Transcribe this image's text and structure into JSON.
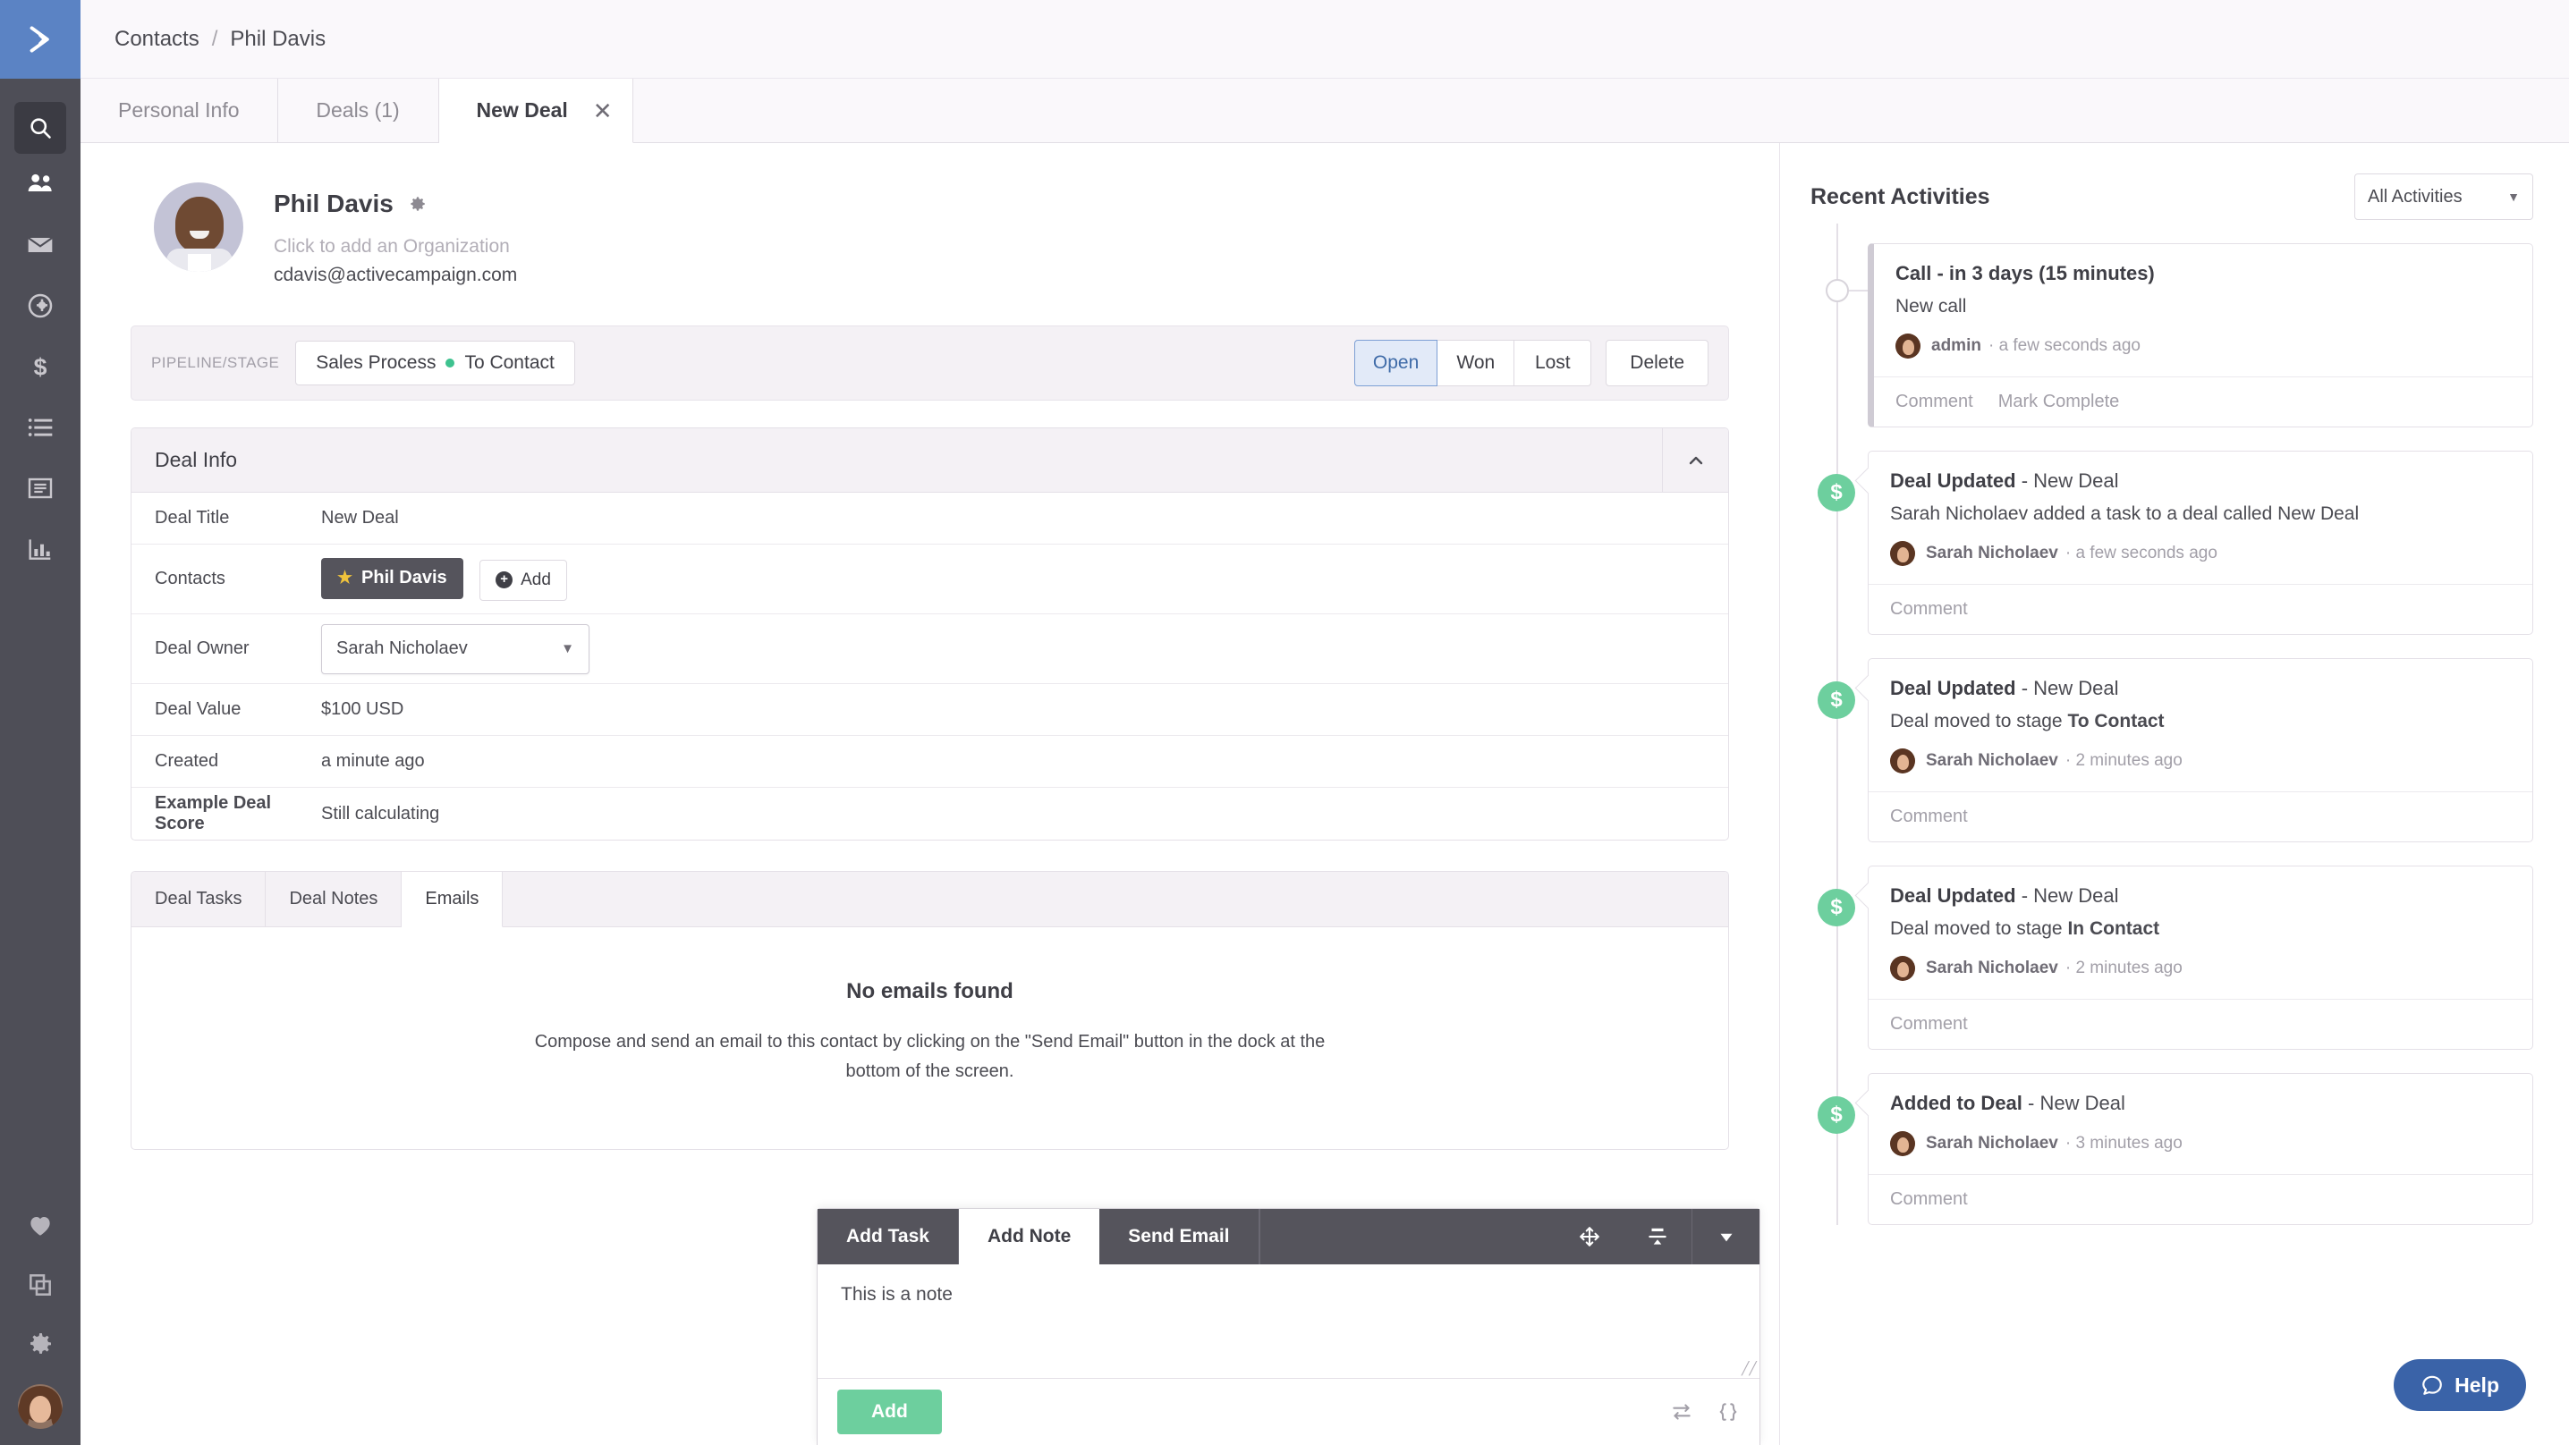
{
  "sidebar": {
    "logo_icon": "chevron-right-logo-icon",
    "search_icon": "search-icon",
    "items": [
      {
        "icon": "contacts-people-icon",
        "name": "contacts"
      },
      {
        "icon": "envelope-campaigns-icon",
        "name": "campaigns"
      },
      {
        "icon": "automations-gear-circle-icon",
        "name": "automations"
      },
      {
        "icon": "deals-dollar-icon",
        "name": "deals"
      },
      {
        "icon": "lists-icon",
        "name": "lists"
      },
      {
        "icon": "forms-document-icon",
        "name": "forms"
      },
      {
        "icon": "reports-bar-chart-icon",
        "name": "reports"
      }
    ],
    "bottom_items": [
      {
        "icon": "heart-icon",
        "name": "favorites"
      },
      {
        "icon": "layers-copy-icon",
        "name": "apps"
      },
      {
        "icon": "gear-settings-icon",
        "name": "settings"
      }
    ],
    "avatar_name": "user-avatar"
  },
  "breadcrumb": {
    "root": "Contacts",
    "separator": "/",
    "current": "Phil Davis"
  },
  "tabs": [
    {
      "label": "Personal Info",
      "active": false,
      "closable": false
    },
    {
      "label": "Deals (1)",
      "active": false,
      "closable": false
    },
    {
      "label": "New Deal",
      "active": true,
      "closable": true
    }
  ],
  "tab_close_glyph": "✕",
  "contact": {
    "name": "Phil Davis",
    "settings_icon": "gear-icon",
    "organization_placeholder": "Click to add an Organization",
    "email": "cdavis@activecampaign.com"
  },
  "pipeline": {
    "label": "PIPELINE/STAGE",
    "pipeline_name": "Sales Process",
    "stage_name": "To Contact",
    "stage_dot_color": "#3ec28f",
    "status_buttons": [
      {
        "label": "Open",
        "active": true
      },
      {
        "label": "Won",
        "active": false
      },
      {
        "label": "Lost",
        "active": false
      }
    ],
    "delete_label": "Delete"
  },
  "deal_info": {
    "title": "Deal Info",
    "collapse_icon": "chevron-up-icon",
    "rows": [
      {
        "label": "Deal Title",
        "value": "New Deal"
      },
      {
        "label": "Contacts",
        "value": ""
      },
      {
        "label": "Deal Owner",
        "value": "Sarah Nicholaev"
      },
      {
        "label": "Deal Value",
        "value": "$100 USD"
      },
      {
        "label": "Created",
        "value": "a minute ago"
      },
      {
        "label": "Example Deal Score",
        "value": "Still calculating"
      }
    ],
    "contact_chip": {
      "star_glyph": "★",
      "label": "Phil Davis"
    },
    "add_contact_label": "Add",
    "add_contact_icon": "plus-circle-icon",
    "owner_value": "Sarah Nicholaev",
    "owner_caret": "▼"
  },
  "deal_tabs": {
    "items": [
      {
        "label": "Deal Tasks",
        "active": false
      },
      {
        "label": "Deal Notes",
        "active": false
      },
      {
        "label": "Emails",
        "active": true
      }
    ],
    "empty_title": "No emails found",
    "empty_body": "Compose and send an email to this contact by clicking on the \"Send Email\" button in the dock at the bottom of the screen."
  },
  "activities": {
    "title": "Recent Activities",
    "filter_value": "All Activities",
    "filter_caret": "▼",
    "items": [
      {
        "kind": "task",
        "marker": "hollow",
        "heading_bold": "Call - in 3 days (15 minutes)",
        "heading_rest": "",
        "description": "New call",
        "author": "admin",
        "time": "a few seconds ago",
        "actions": [
          "Comment",
          "Mark Complete"
        ]
      },
      {
        "kind": "deal",
        "marker": "dollar",
        "heading_bold": "Deal Updated",
        "heading_rest": " - New Deal",
        "description": "Sarah Nicholaev added a task to a deal called New Deal",
        "description_strong": "",
        "author": "Sarah Nicholaev",
        "time": "a few seconds ago",
        "actions": [
          "Comment"
        ]
      },
      {
        "kind": "deal",
        "marker": "dollar",
        "heading_bold": "Deal Updated",
        "heading_rest": " - New Deal",
        "description": "Deal moved to stage ",
        "description_strong": "To Contact",
        "author": "Sarah Nicholaev",
        "time": "2 minutes ago",
        "actions": [
          "Comment"
        ]
      },
      {
        "kind": "deal",
        "marker": "dollar",
        "heading_bold": "Deal Updated",
        "heading_rest": " - New Deal",
        "description": "Deal moved to stage ",
        "description_strong": "In Contact",
        "author": "Sarah Nicholaev",
        "time": "2 minutes ago",
        "actions": [
          "Comment"
        ]
      },
      {
        "kind": "deal",
        "marker": "dollar",
        "heading_bold": "Added to Deal",
        "heading_rest": " - New Deal",
        "description": "",
        "description_strong": "",
        "author": "Sarah Nicholaev",
        "time": "3 minutes ago",
        "actions": [
          "Comment"
        ]
      }
    ],
    "marker_glyph": "$",
    "marker_color": "#6dcf9e"
  },
  "dock": {
    "tabs": [
      {
        "label": "Add Task",
        "active": false
      },
      {
        "label": "Add Note",
        "active": true
      },
      {
        "label": "Send Email",
        "active": false
      }
    ],
    "move_icon": "move-arrows-icon",
    "collapse_icon": "collapse-icon",
    "chevron_icon": "chevron-down-icon",
    "note_text": "This is a note",
    "resize_glyph": "╱╱",
    "submit_label": "Add",
    "submit_color": "#6dcf9e",
    "footer_icons": [
      "exchange-arrows-icon",
      "code-braces-icon"
    ]
  },
  "help": {
    "label": "Help",
    "icon": "chat-bubble-icon",
    "color": "#3a63a8"
  }
}
